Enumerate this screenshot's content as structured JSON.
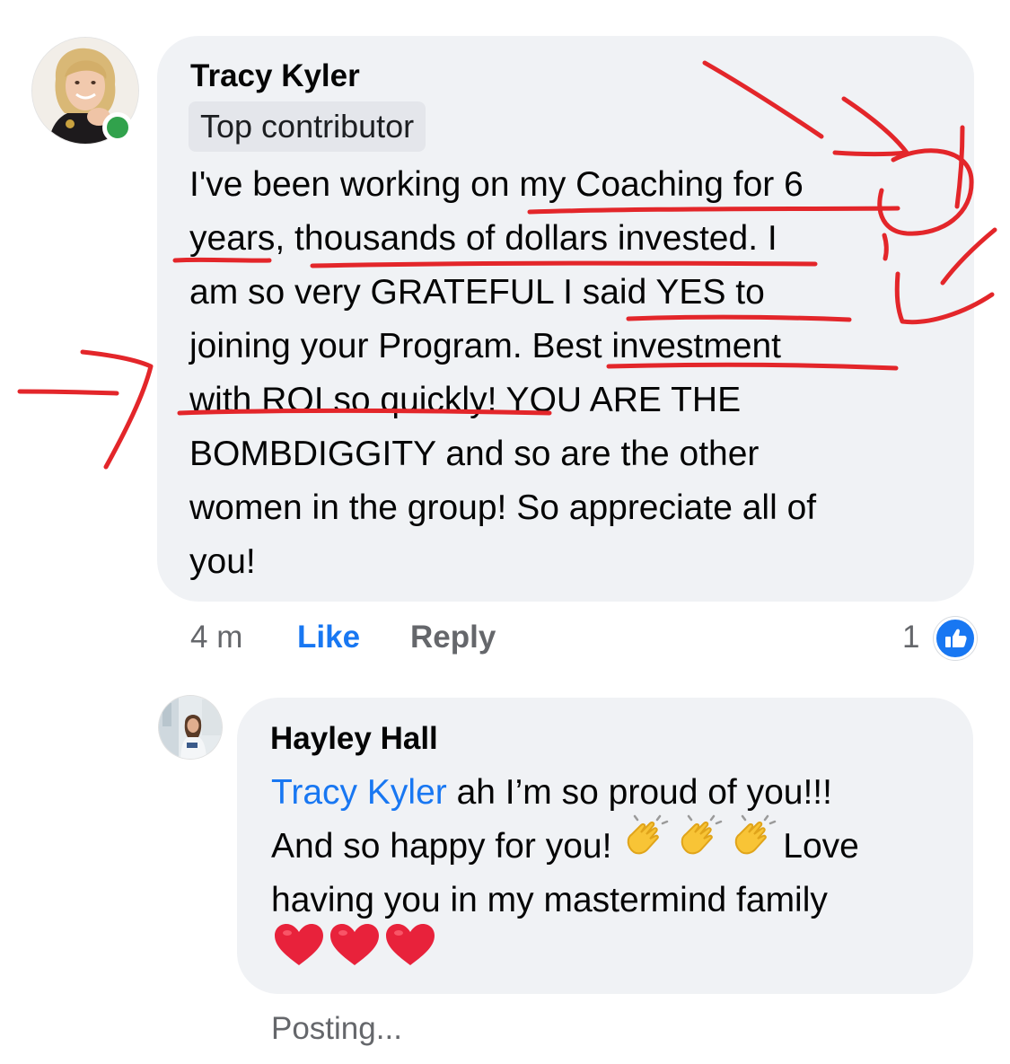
{
  "comment_1": {
    "author": "Tracy Kyler",
    "badge": "Top contributor",
    "online": true,
    "lines": [
      "I've been working on my Coaching for 6",
      "years, thousands of dollars invested.  I",
      "am so very GRATEFUL I said YES to",
      "joining your Program.  Best investment",
      "with ROI so quickly!  YOU ARE THE",
      "BOMBDIGGITY and so are the other",
      "women in the group!  So appreciate all of",
      "you!"
    ],
    "time": "4 m",
    "like_label": "Like",
    "reply_label": "Reply",
    "reaction_count": "1",
    "reaction_icon": "thumbs-up-icon"
  },
  "comment_2": {
    "author": "Hayley Hall",
    "mention": "Tracy Kyler",
    "line_1_rest": " ah I’m so proud of you!!!",
    "line_2_text": "And so happy for you! ",
    "clap_emojis": [
      "👏",
      "👏",
      "👏"
    ],
    "line_2_rest": "Love",
    "line_3": "having you in my mastermind family",
    "heart_emojis": [
      "❤️",
      "❤️",
      "❤️"
    ],
    "status": "Posting..."
  },
  "colors": {
    "bubble": "#f0f2f5",
    "badge_bg": "#e4e6eb",
    "link_blue": "#1877f2",
    "meta_gray": "#65676b",
    "online_green": "#31a24c",
    "annotation_red": "#e3262a",
    "clap_yellow": "#f8c436",
    "heart_red": "#e8223b"
  }
}
